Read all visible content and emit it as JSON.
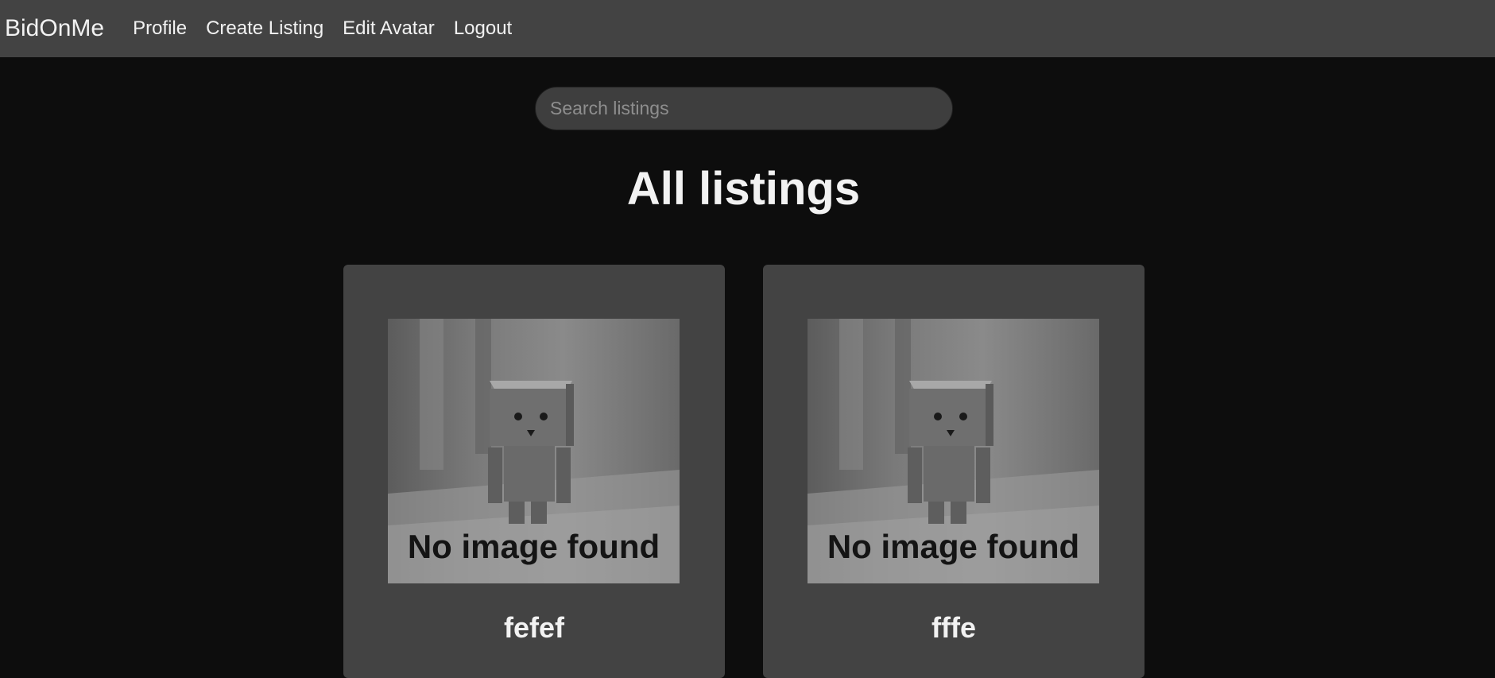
{
  "nav": {
    "brand": "BidOnMe",
    "links": [
      "Profile",
      "Create Listing",
      "Edit Avatar",
      "Logout"
    ]
  },
  "search": {
    "placeholder": "Search listings",
    "value": ""
  },
  "page": {
    "title": "All listings"
  },
  "listings": [
    {
      "title": "fefef",
      "image_text": "No image found",
      "image_icon": "sad-box-robot-placeholder-icon"
    },
    {
      "title": "fffe",
      "image_text": "No image found",
      "image_icon": "sad-box-robot-placeholder-icon"
    }
  ],
  "colors": {
    "background": "#0d0d0d",
    "navbar": "#434343",
    "card": "#434343",
    "text": "#f2f2f2"
  }
}
